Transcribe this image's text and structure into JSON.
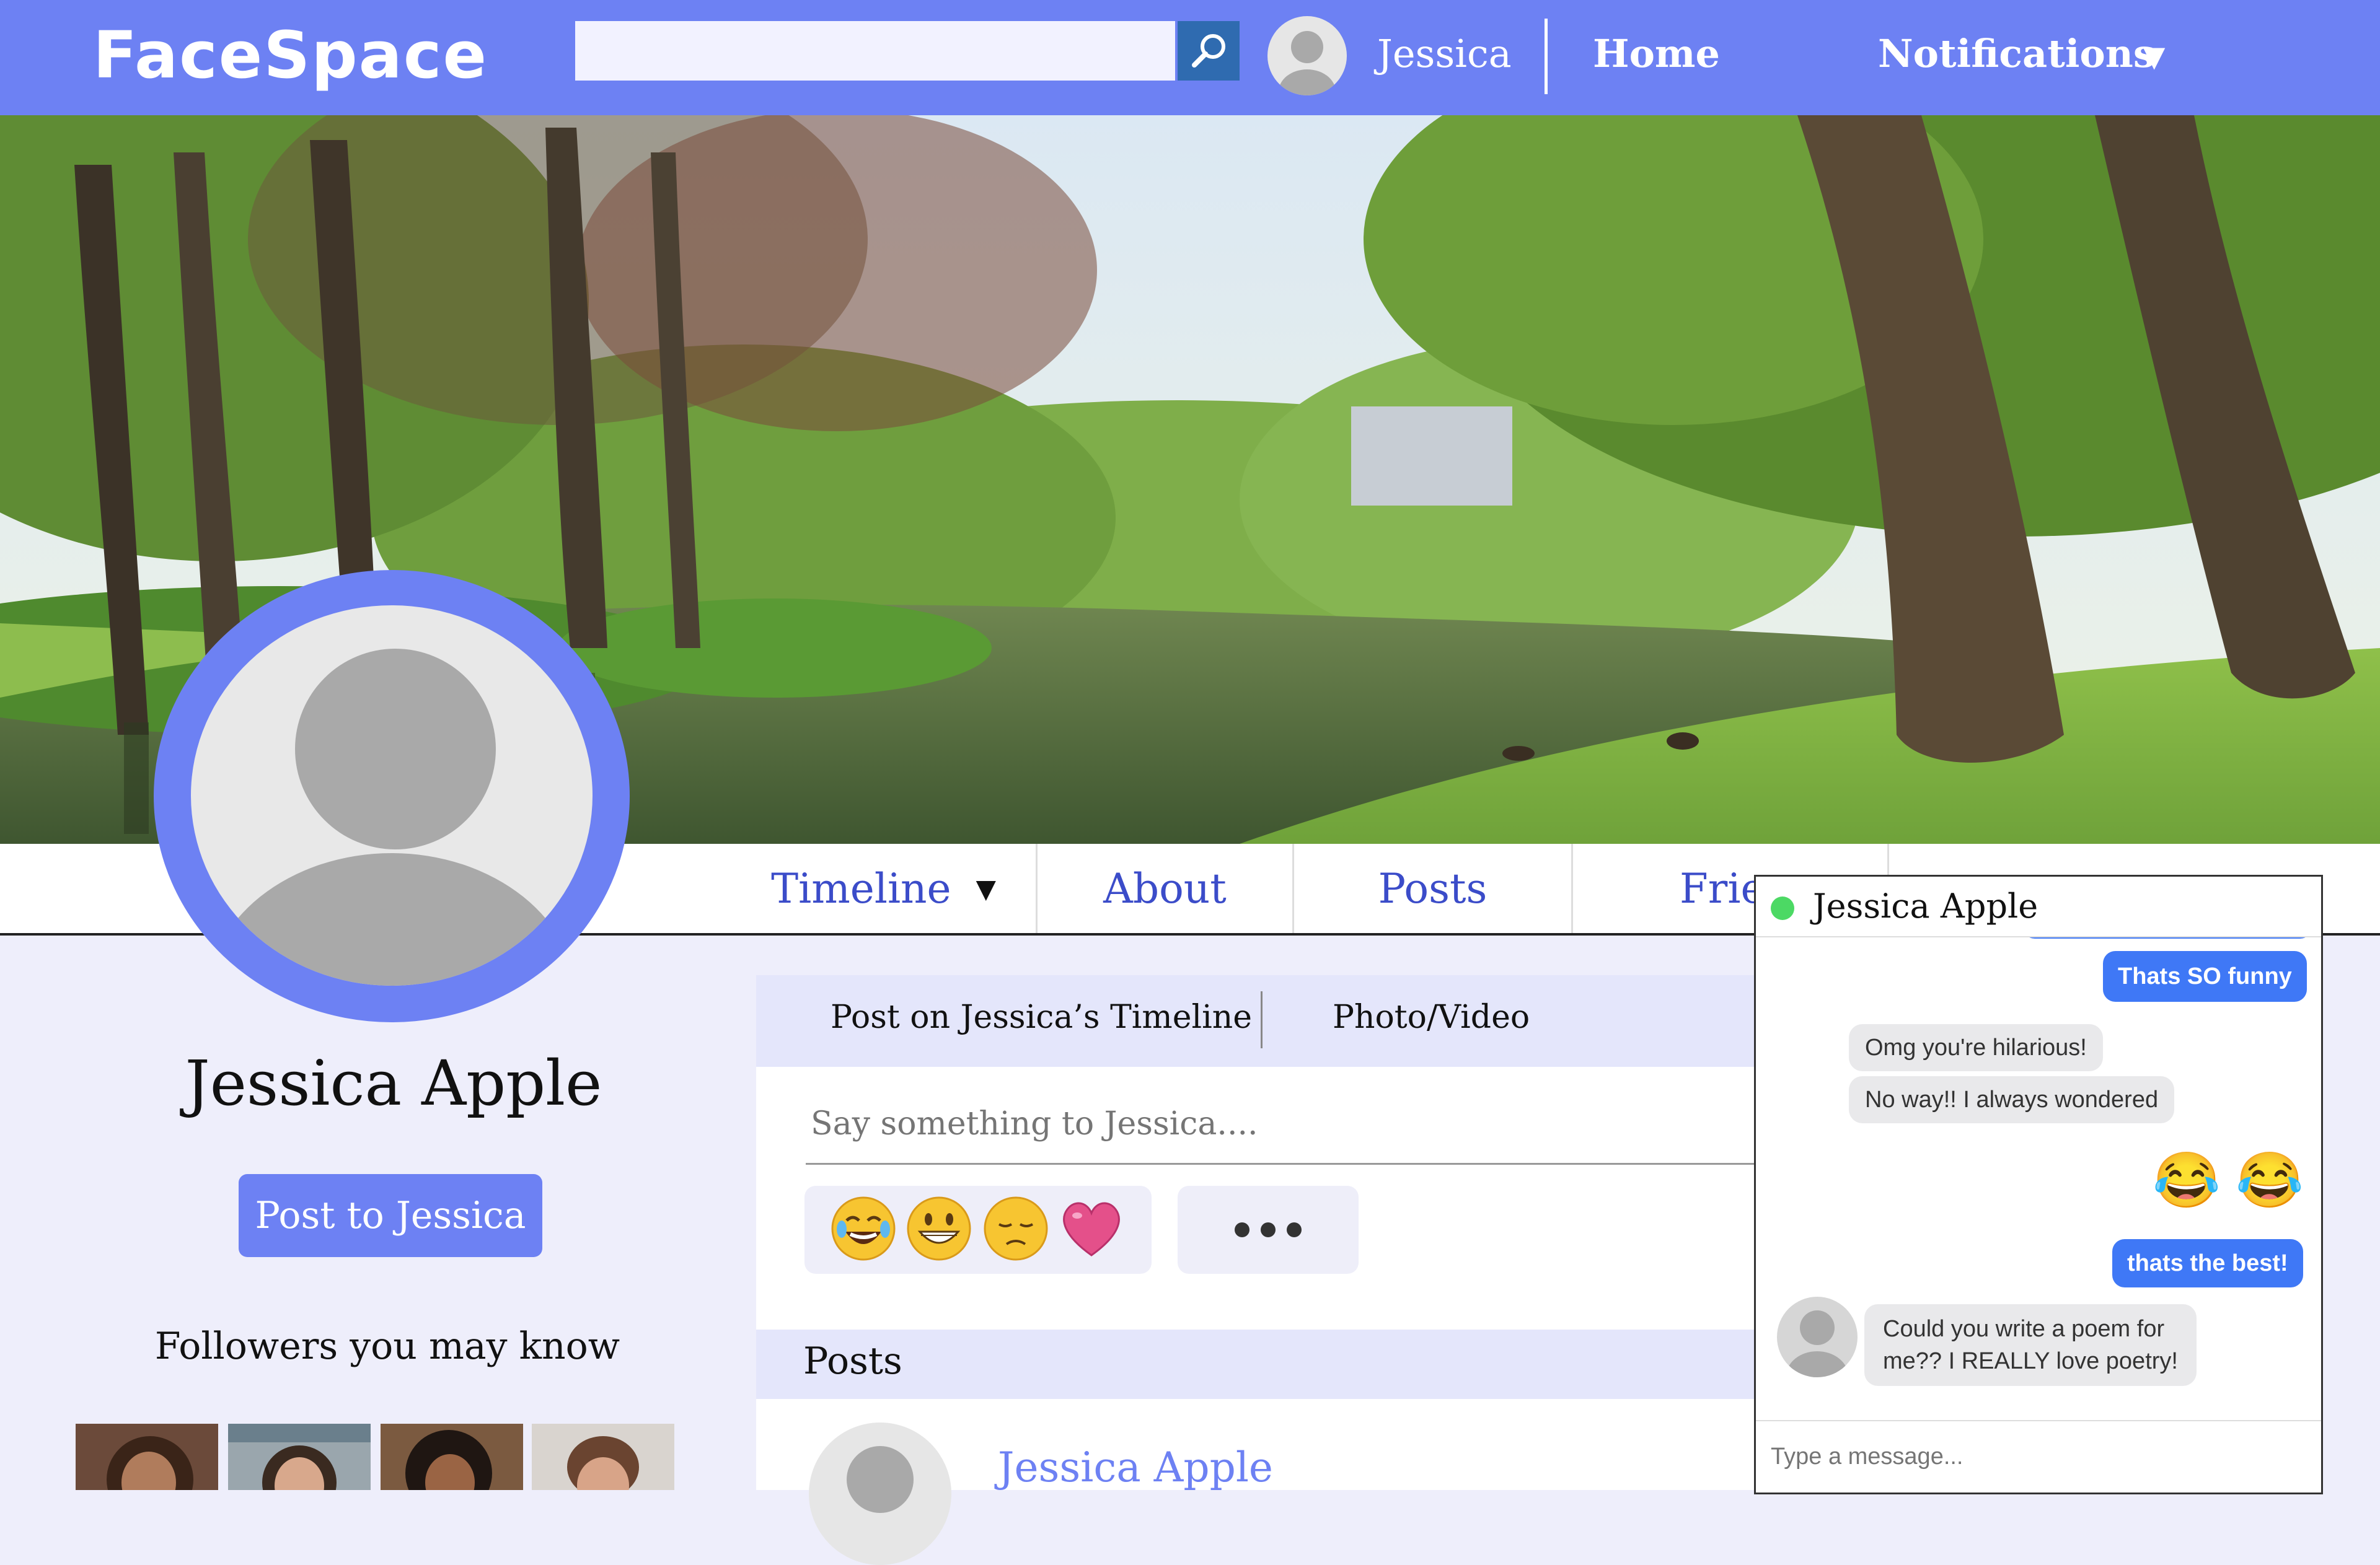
{
  "app": {
    "name": "FaceSpace"
  },
  "header": {
    "search": {
      "value": "",
      "placeholder": ""
    },
    "user_name": "Jessica",
    "nav": {
      "home": "Home",
      "notifications": "Notifications"
    }
  },
  "tabs": [
    "Timeline",
    "About",
    "Posts",
    "Frie"
  ],
  "profile": {
    "name": "Jessica Apple",
    "post_button": "Post to Jessica",
    "followers_title": "Followers you may know"
  },
  "composer": {
    "tab_post": "Post on Jessica’s Timeline",
    "tab_photo": "Photo/Video",
    "placeholder": "Say something to Jessica....",
    "emojis": [
      "😂",
      "😁",
      "😔",
      "💗"
    ]
  },
  "posts": {
    "title": "Posts",
    "first_author": "Jessica Apple"
  },
  "chat": {
    "name": "Jessica Apple",
    "messages": [
      {
        "from": "me",
        "text": "Thats SO funny"
      },
      {
        "from": "them",
        "text": "Omg you're hilarious!"
      },
      {
        "from": "them",
        "text": "No way!! I always wondered"
      },
      {
        "from": "me",
        "text": "😂 😂"
      },
      {
        "from": "me",
        "text": "thats the best!"
      },
      {
        "from": "them",
        "text": "Could you write a poem for"
      },
      {
        "from": "them",
        "text": "me?? I REALLY love poetry!"
      }
    ],
    "input_placeholder": "Type a message..."
  },
  "colors": {
    "brand": "#6d81f3",
    "tab_text": "#3b4cc9",
    "chat_outgoing": "#3f78f6",
    "chat_incoming": "#e9e9eb",
    "online": "#4cd964"
  }
}
